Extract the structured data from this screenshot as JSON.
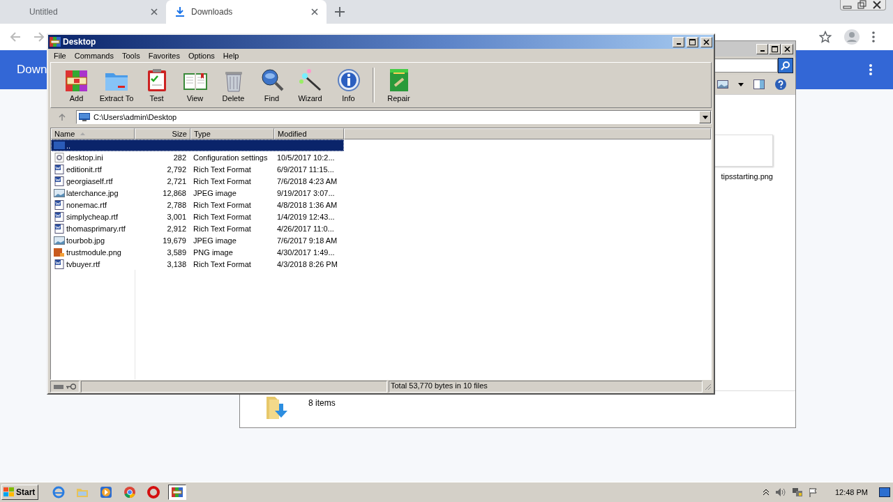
{
  "browser": {
    "tabs": [
      {
        "title": "Untitled",
        "selected": false
      },
      {
        "title": "Downloads",
        "selected": true
      }
    ],
    "page_header": {
      "title": "Down"
    }
  },
  "explorer_window": {
    "thumbnail_label": "tipsstarting.png",
    "status": "8 items"
  },
  "winrar": {
    "title": "Desktop",
    "menu": [
      "File",
      "Commands",
      "Tools",
      "Favorites",
      "Options",
      "Help"
    ],
    "toolbar": [
      {
        "label": "Add",
        "kind": "add"
      },
      {
        "label": "Extract To",
        "kind": "extract"
      },
      {
        "label": "Test",
        "kind": "test"
      },
      {
        "label": "View",
        "kind": "view"
      },
      {
        "label": "Delete",
        "kind": "delete"
      },
      {
        "label": "Find",
        "kind": "find"
      },
      {
        "label": "Wizard",
        "kind": "wizard"
      },
      {
        "label": "Info",
        "kind": "info"
      },
      {
        "label": "Repair",
        "kind": "repair"
      }
    ],
    "path": "C:\\Users\\admin\\Desktop",
    "columns": [
      {
        "label": "Name",
        "sorted": true
      },
      {
        "label": "Size",
        "sorted": false
      },
      {
        "label": "Type",
        "sorted": false
      },
      {
        "label": "Modified",
        "sorted": false
      }
    ],
    "rows": [
      {
        "name": "..",
        "kind": "up",
        "selected": true
      },
      {
        "name": "desktop.ini",
        "size": "282",
        "type": "Configuration settings",
        "modified": "10/5/2017 10:2...",
        "kind": "ini",
        "selected": false
      },
      {
        "name": "editionit.rtf",
        "size": "2,792",
        "type": "Rich Text Format",
        "modified": "6/9/2017 11:15...",
        "kind": "rtf",
        "selected": false
      },
      {
        "name": "georgiaself.rtf",
        "size": "2,721",
        "type": "Rich Text Format",
        "modified": "7/6/2018 4:23 AM",
        "kind": "rtf",
        "selected": false
      },
      {
        "name": "laterchance.jpg",
        "size": "12,868",
        "type": "JPEG image",
        "modified": "9/19/2017 3:07...",
        "kind": "jpg",
        "selected": false
      },
      {
        "name": "nonemac.rtf",
        "size": "2,788",
        "type": "Rich Text Format",
        "modified": "4/8/2018 1:36 AM",
        "kind": "rtf",
        "selected": false
      },
      {
        "name": "simplycheap.rtf",
        "size": "3,001",
        "type": "Rich Text Format",
        "modified": "1/4/2019 12:43...",
        "kind": "rtf",
        "selected": false
      },
      {
        "name": "thomasprimary.rtf",
        "size": "2,912",
        "type": "Rich Text Format",
        "modified": "4/26/2017 11:0...",
        "kind": "rtf",
        "selected": false
      },
      {
        "name": "tourbob.jpg",
        "size": "19,679",
        "type": "JPEG image",
        "modified": "7/6/2017 9:18 AM",
        "kind": "jpg",
        "selected": false
      },
      {
        "name": "trustmodule.png",
        "size": "3,589",
        "type": "PNG image",
        "modified": "4/30/2017 1:49...",
        "kind": "png",
        "selected": false
      },
      {
        "name": "tvbuyer.rtf",
        "size": "3,138",
        "type": "Rich Text Format",
        "modified": "4/3/2018 8:26 PM",
        "kind": "rtf",
        "selected": false
      }
    ],
    "status": "Total 53,770 bytes in 10 files"
  },
  "taskbar": {
    "start": "Start",
    "apps": [
      {
        "kind": "browser",
        "selected": false
      },
      {
        "kind": "folder",
        "selected": false
      },
      {
        "kind": "media",
        "selected": false
      },
      {
        "kind": "chrome",
        "selected": false
      },
      {
        "kind": "opera",
        "selected": false
      },
      {
        "kind": "archiver",
        "selected": true
      }
    ],
    "clock": "12:48 PM"
  }
}
